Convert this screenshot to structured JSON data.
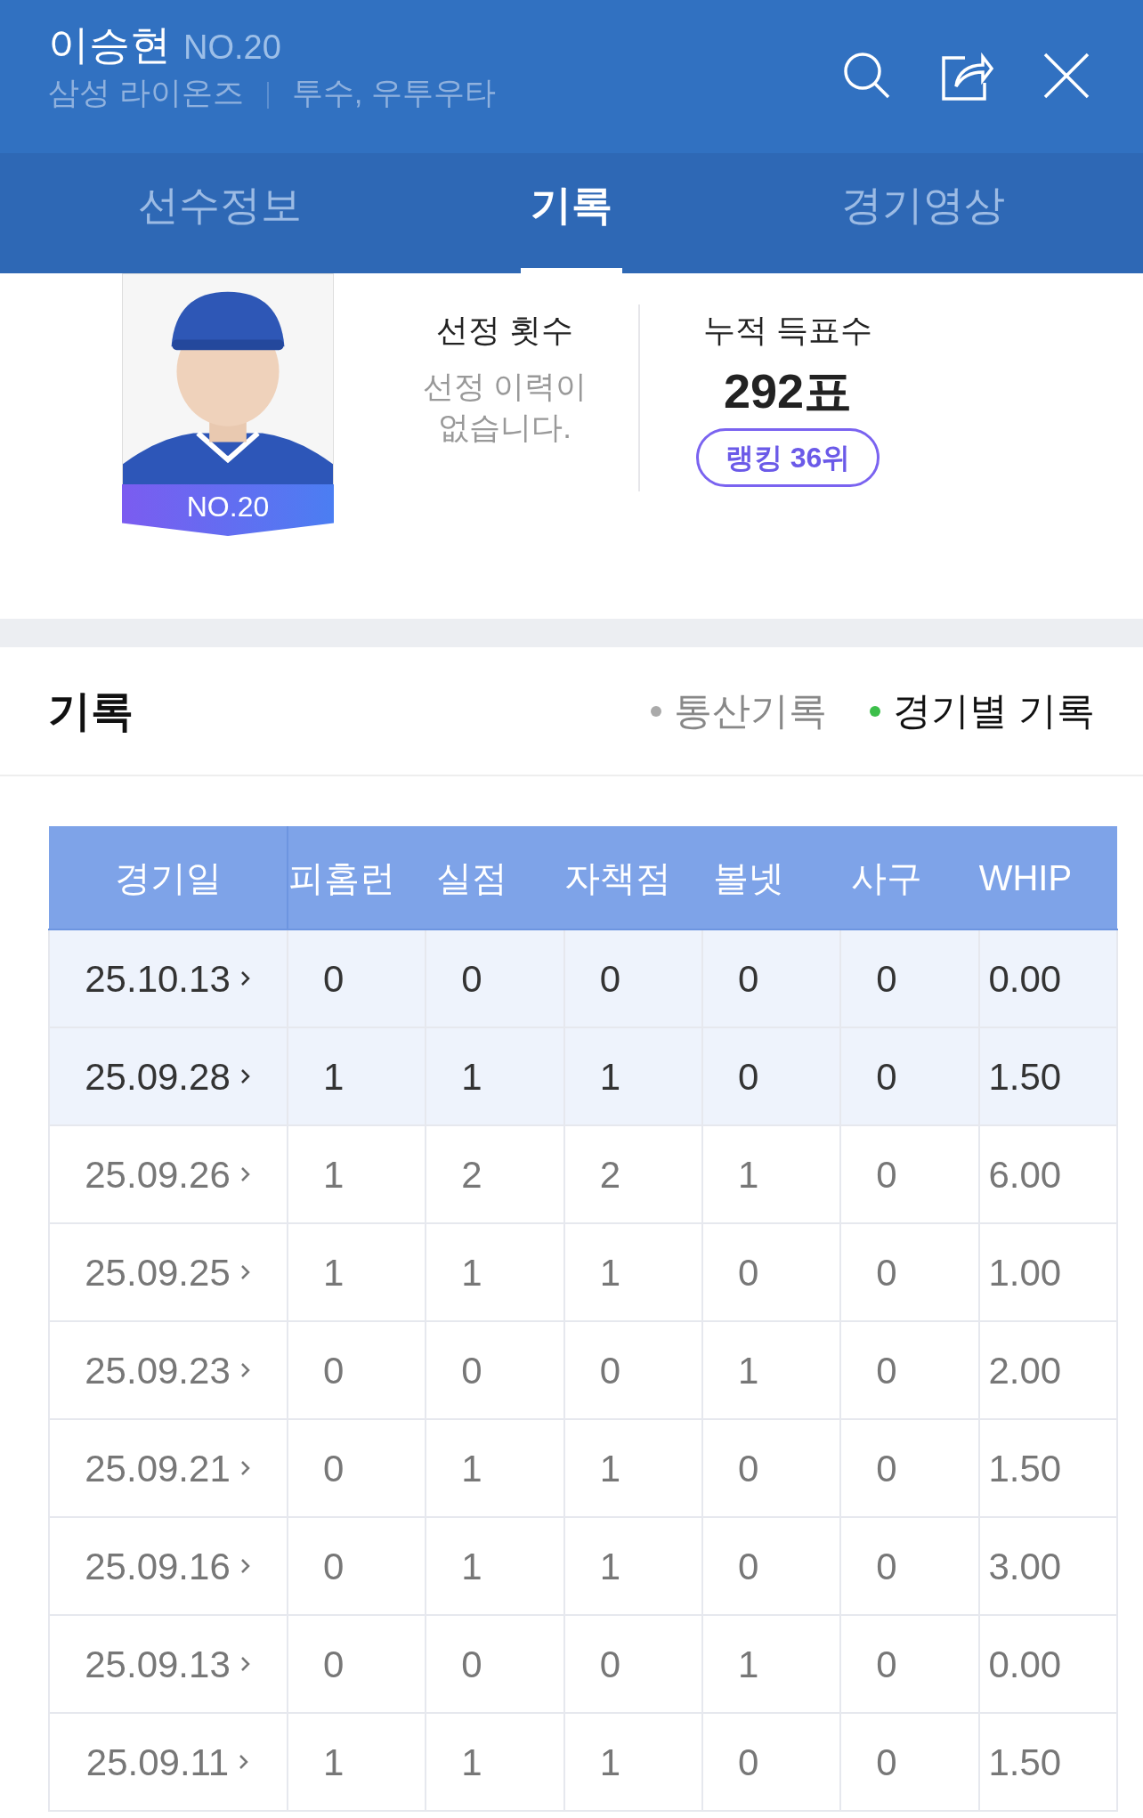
{
  "header": {
    "name": "이승현",
    "number": "NO.20",
    "team": "삼성 라이온즈",
    "position": "투수, 우투우타"
  },
  "tabs": [
    {
      "label": "선수정보",
      "selected": false
    },
    {
      "label": "기록",
      "selected": true
    },
    {
      "label": "경기영상",
      "selected": false
    }
  ],
  "profile": {
    "badge": "NO.20",
    "selection": {
      "label": "선정 횟수",
      "value": "선정 이력이\n없습니다."
    },
    "votes": {
      "label": "누적 득표수",
      "value": "292표",
      "ranking": "랭킹 36위"
    }
  },
  "records": {
    "title": "기록",
    "filters": [
      {
        "label": "통산기록",
        "selected": false
      },
      {
        "label": "경기별 기록",
        "selected": true
      }
    ],
    "table": {
      "columns": [
        "경기일",
        "피홈런",
        "실점",
        "자책점",
        "볼넷",
        "사구",
        "WHIP"
      ],
      "rows": [
        {
          "highlighted": true,
          "cells": [
            "25.10.13",
            "0",
            "0",
            "0",
            "0",
            "0",
            "0.00"
          ]
        },
        {
          "highlighted": true,
          "cells": [
            "25.09.28",
            "1",
            "1",
            "1",
            "0",
            "0",
            "1.50"
          ]
        },
        {
          "highlighted": false,
          "cells": [
            "25.09.26",
            "1",
            "2",
            "2",
            "1",
            "0",
            "6.00"
          ]
        },
        {
          "highlighted": false,
          "cells": [
            "25.09.25",
            "1",
            "1",
            "1",
            "0",
            "0",
            "1.00"
          ]
        },
        {
          "highlighted": false,
          "cells": [
            "25.09.23",
            "0",
            "0",
            "0",
            "1",
            "0",
            "2.00"
          ]
        },
        {
          "highlighted": false,
          "cells": [
            "25.09.21",
            "0",
            "1",
            "1",
            "0",
            "0",
            "1.50"
          ]
        },
        {
          "highlighted": false,
          "cells": [
            "25.09.16",
            "0",
            "1",
            "1",
            "0",
            "0",
            "3.00"
          ]
        },
        {
          "highlighted": false,
          "cells": [
            "25.09.13",
            "0",
            "0",
            "0",
            "1",
            "0",
            "0.00"
          ]
        },
        {
          "highlighted": false,
          "cells": [
            "25.09.11",
            "1",
            "1",
            "1",
            "0",
            "0",
            "1.50"
          ]
        }
      ]
    }
  }
}
